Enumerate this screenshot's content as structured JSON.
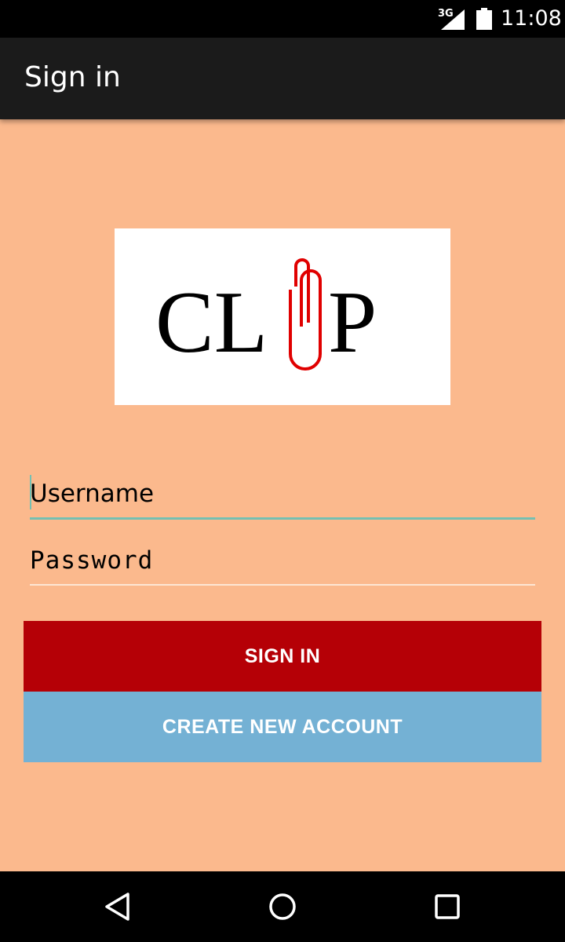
{
  "status_bar": {
    "network": "3G",
    "time": "11:08",
    "signal_icon": "cell-signal-icon",
    "battery_icon": "battery-icon"
  },
  "app_bar": {
    "title": "Sign in"
  },
  "logo": {
    "text": "CLIP",
    "icon": "paperclip-icon",
    "clip_color": "#e00000"
  },
  "form": {
    "username": {
      "placeholder": "Username",
      "value": ""
    },
    "password": {
      "placeholder": "Password",
      "value": ""
    }
  },
  "buttons": {
    "sign_in": "SIGN IN",
    "create_account": "CREATE NEW ACCOUNT"
  },
  "colors": {
    "background": "#fbb98d",
    "sign_in_button": "#b50006",
    "create_button": "#74b1d4",
    "focus_accent": "#74c0b2"
  },
  "nav_bar": {
    "icons": [
      "back-icon",
      "home-icon",
      "recents-icon"
    ]
  }
}
